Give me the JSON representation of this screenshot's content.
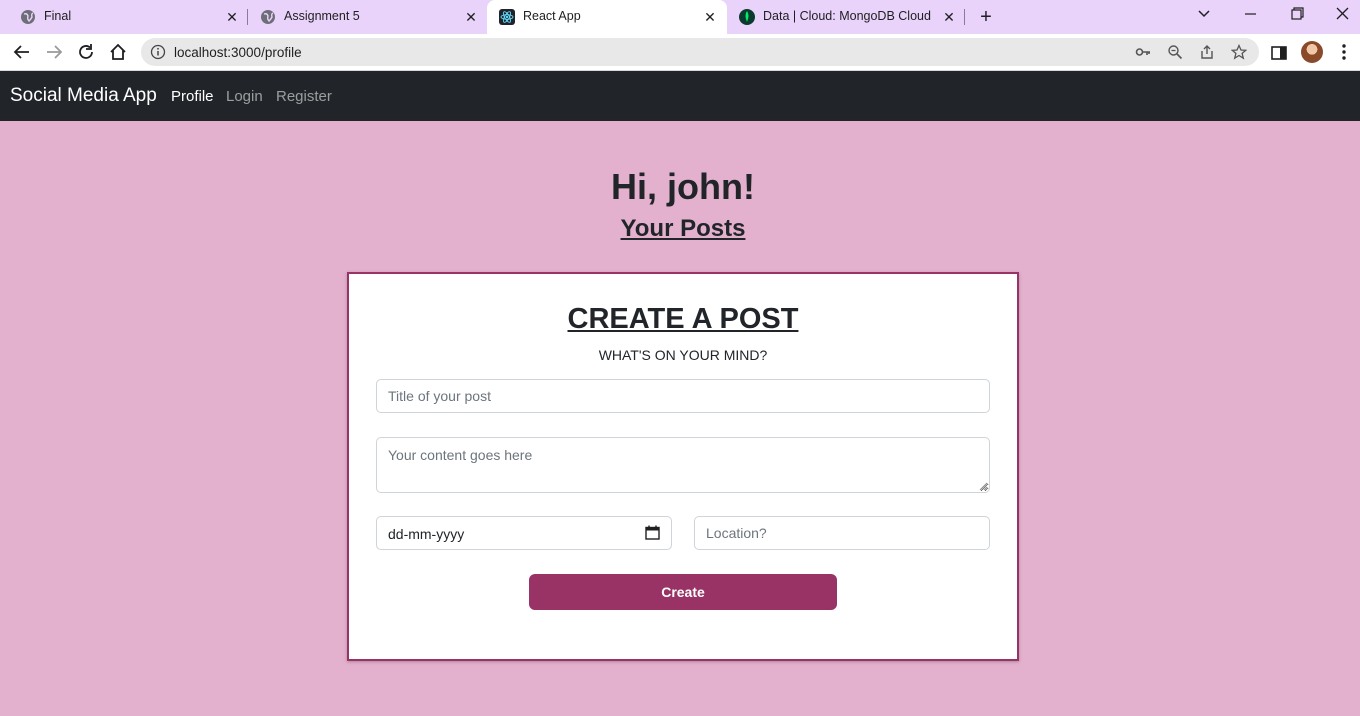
{
  "browser": {
    "tabs": [
      {
        "title": "Final",
        "icon": "globe-icon",
        "active": false
      },
      {
        "title": "Assignment 5",
        "icon": "globe-icon",
        "active": false
      },
      {
        "title": "React App",
        "icon": "react-logo-icon",
        "active": true
      },
      {
        "title": "Data | Cloud: MongoDB Cloud",
        "icon": "mongodb-leaf-icon",
        "active": false
      }
    ],
    "url": "localhost:3000/profile"
  },
  "navbar": {
    "brand": "Social Media App",
    "links": [
      "Profile",
      "Login",
      "Register"
    ],
    "active_link": "Profile"
  },
  "profile": {
    "greeting": "Hi, john!",
    "posts_heading": "Your Posts"
  },
  "create_post": {
    "title": "CREATE A POST",
    "subtitle": "WHAT'S ON YOUR MIND?",
    "title_placeholder": "Title of your post",
    "content_placeholder": "Your content goes here",
    "date_value": "dd-mm-yyyy",
    "location_placeholder": "Location?",
    "submit_label": "Create"
  },
  "colors": {
    "page_background": "#e3b1cd",
    "navbar_background": "#212529",
    "accent": "#993366",
    "tabstrip_background": "#e9d3fb"
  }
}
